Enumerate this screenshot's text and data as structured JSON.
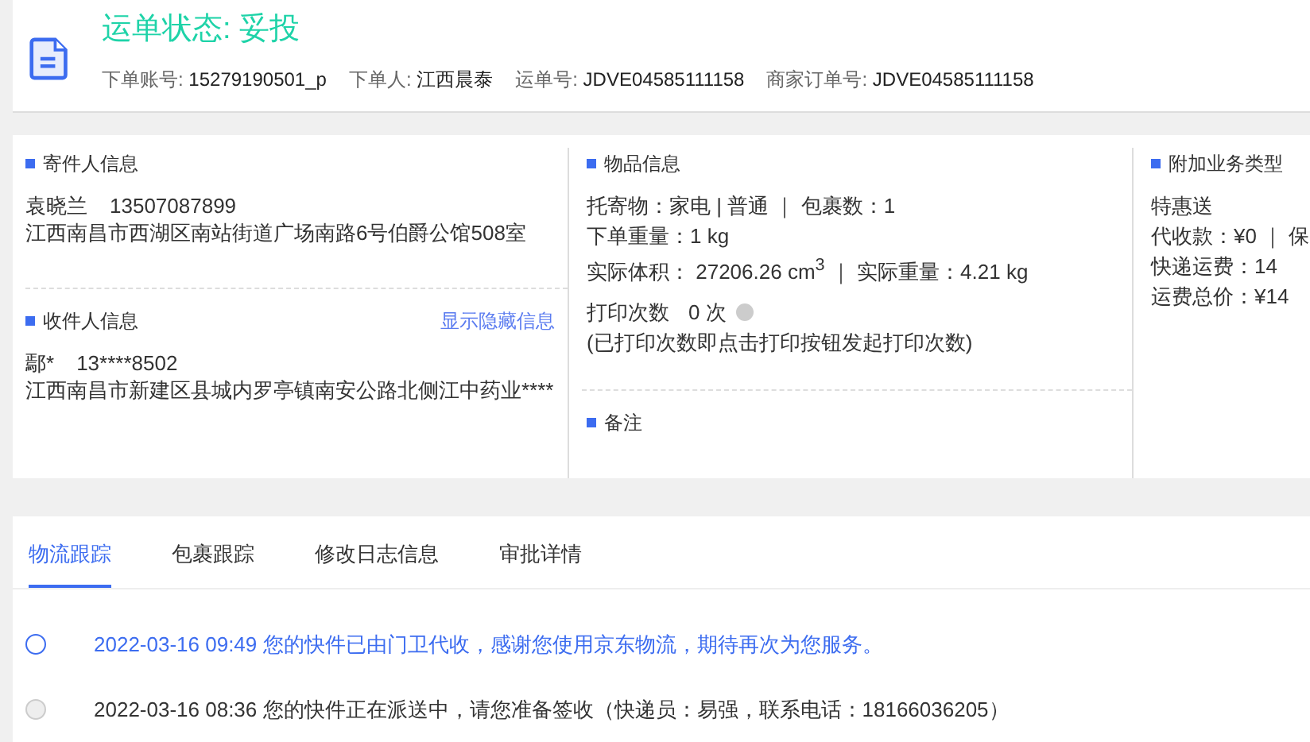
{
  "header": {
    "title": "运单状态: 妥投",
    "meta": [
      {
        "label": "下单账号:",
        "value": "15279190501_p"
      },
      {
        "label": "下单人:",
        "value": "江西晨泰"
      },
      {
        "label": "运单号:",
        "value": "JDVE04585111158"
      },
      {
        "label": "商家订单号:",
        "value": "JDVE04585111158"
      }
    ]
  },
  "sender": {
    "heading": "寄件人信息",
    "name": "袁晓兰",
    "phone": "13507087899",
    "address": "江西南昌市西湖区南站街道广场南路6号伯爵公馆508室"
  },
  "receiver": {
    "heading": "收件人信息",
    "link": "显示隐藏信息",
    "name": "鄢*",
    "phone": "13****8502",
    "address": "江西南昌市新建区县城内罗亭镇南安公路北侧江中药业****"
  },
  "goods": {
    "heading": "物品信息",
    "lines": [
      "托寄物：家电 | 普通 ｜ 包裹数：1",
      "下单重量：1 kg",
      "实际体积：  27206.26 cm$^{3}$ ｜ 实际重量：4.21 kg"
    ],
    "print_label": "打印次数",
    "print_count": "0 次",
    "print_note": "(已打印次数即点击打印按钮发起打印次数)"
  },
  "remark": {
    "heading": "备注"
  },
  "extra": {
    "heading": "附加业务类型",
    "lines": [
      "特惠送",
      "代收款：¥0 ｜ 保",
      "快递运费：14",
      "运费总价：¥14"
    ]
  },
  "tabs": [
    {
      "label": "物流跟踪",
      "selected": true
    },
    {
      "label": "包裹跟踪",
      "selected": false
    },
    {
      "label": "修改日志信息",
      "selected": false
    },
    {
      "label": "审批详情",
      "selected": false
    }
  ],
  "timeline": [
    {
      "text": "2022-03-16 09:49 您的快件已由门卫代收，感谢您使用京东物流，期待再次为您服务。",
      "current": true
    },
    {
      "text": "2022-03-16 08:36 您的快件正在派送中，请您准备签收（快递员：易强，联系电话：18166036205）",
      "current": false
    }
  ]
}
